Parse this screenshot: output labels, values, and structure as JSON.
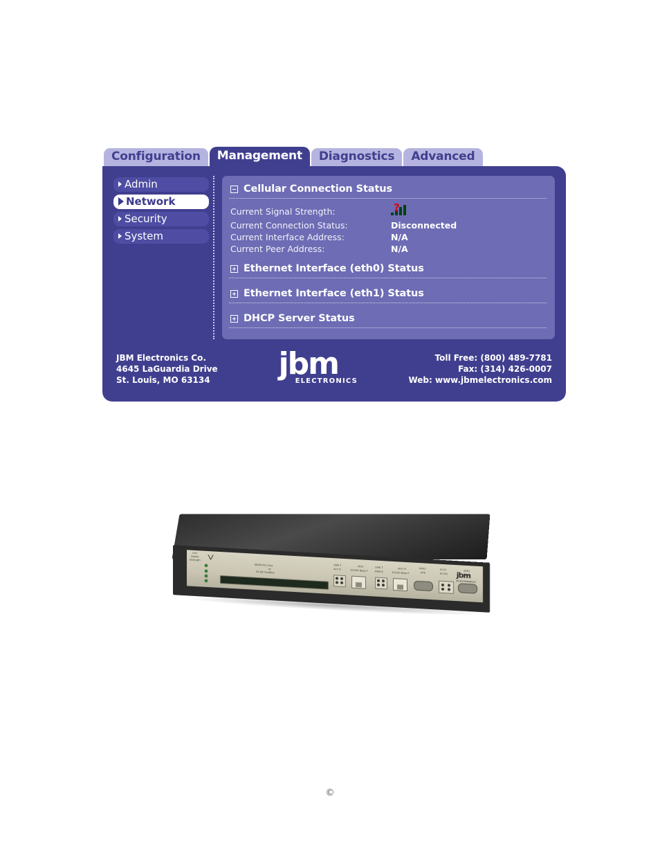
{
  "tabs": [
    {
      "label": "Configuration",
      "active": false
    },
    {
      "label": "Management",
      "active": true
    },
    {
      "label": "Diagnostics",
      "active": false
    },
    {
      "label": "Advanced",
      "active": false
    }
  ],
  "sidebar": {
    "items": [
      {
        "label": "Admin",
        "selected": false
      },
      {
        "label": "Network",
        "selected": true
      },
      {
        "label": "Security",
        "selected": false
      },
      {
        "label": "System",
        "selected": false
      }
    ]
  },
  "content": {
    "sections": [
      {
        "title": "Cellular Connection Status",
        "expanded": true,
        "toggle_icon": "minus-box-icon"
      },
      {
        "title": "Ethernet Interface (eth0) Status",
        "expanded": false,
        "toggle_icon": "plus-box-icon"
      },
      {
        "title": "Ethernet Interface (eth1) Status",
        "expanded": false,
        "toggle_icon": "plus-box-icon"
      },
      {
        "title": "DHCP Server Status",
        "expanded": false,
        "toggle_icon": "plus-box-icon"
      }
    ],
    "cellular_rows": [
      {
        "label": "Current Signal Strength:",
        "value": "",
        "icon": "signal-bars-unknown-icon"
      },
      {
        "label": "Current Connection Status:",
        "value": "Disconnected",
        "icon": ""
      },
      {
        "label": "Current Interface Address:",
        "value": "N/A",
        "icon": ""
      },
      {
        "label": "Current Peer Address:",
        "value": "N/A",
        "icon": ""
      }
    ]
  },
  "footer": {
    "company": "JBM Electronics Co.",
    "street": "4645 LaGuardia Drive",
    "city": "St. Louis, MO 63134",
    "logo_word": "jbm",
    "logo_sub": "ELECTRONICS",
    "toll_free": "Toll Free: (800) 489-7781",
    "fax": "Fax: (314) 426-0007",
    "web": "Web: www.jbmelectronics.com"
  },
  "device": {
    "brand": "jbm",
    "brand_sub": "ELECTRONICS",
    "labels": {
      "signal_hdr_1": "Cell",
      "signal_hdr_2": "Signal",
      "signal_hdr_3": "Strength",
      "slot_line1": "NEXM PQ Card",
      "slot_line2": "or",
      "slot_line3": "32-bit CardBus",
      "eth0_link": "LINK   T",
      "eth0_act": "ACT    R",
      "eth0_name": "eth0",
      "eth0_speed": "10/100 Base-T",
      "eth1_link": "LINK   T",
      "eth1_act": "PWR   R",
      "eth1_name": "eth1  R",
      "eth1_speed": "10/100 Base-T",
      "aux_port": "AUX1",
      "aux_port_sub": "DTE",
      "io_port": "IO   IO",
      "io_port_sub": "PO   PO",
      "serial_port": "SER1",
      "serial_port_sub": "DTE"
    }
  },
  "page": {
    "copyright_symbol": "©"
  },
  "colors": {
    "panel_dark": "#403f8f",
    "tab_inactive": "#b5b4e0",
    "card": "#6d6cb4",
    "sidebar_item": "#4e4da3",
    "sidebar_selected_bg": "#ffffff",
    "signal_bar": "#00430f",
    "signal_unknown": "#e00000"
  }
}
